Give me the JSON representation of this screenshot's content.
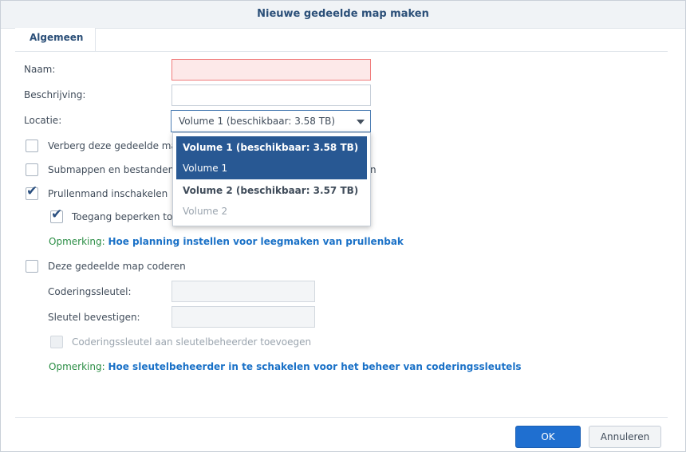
{
  "dialog": {
    "title": "Nieuwe gedeelde map maken"
  },
  "tabs": [
    {
      "label": "Algemeen"
    }
  ],
  "form": {
    "name_label": "Naam:",
    "name_value": "",
    "description_label": "Beschrijving:",
    "description_value": "",
    "location_label": "Locatie:",
    "location_value": "Volume 1 (beschikbaar: 3.58 TB)",
    "hide_folder_label": "Verberg deze gedeelde ma",
    "hide_folder_checked": false,
    "hide_subfolders_label": "Submappen en bestanden",
    "hide_subfolders_suffix": "n",
    "hide_subfolders_checked": false,
    "recycle_bin_label": "Prullenmand inschakelen",
    "recycle_bin_checked": true,
    "restrict_access_label": "Toegang beperken to",
    "restrict_access_checked": true,
    "note1_label": "Opmerking:",
    "note1_link": "Hoe planning instellen voor leegmaken van prullenbak",
    "encrypt_label": "Deze gedeelde map coderen",
    "encrypt_checked": false,
    "encryption_key_label": "Coderingssleutel:",
    "confirm_key_label": "Sleutel bevestigen:",
    "add_to_key_manager_label": "Coderingssleutel aan sleutelbeheerder toevoegen",
    "note2_label": "Opmerking:",
    "note2_link": "Hoe sleutelbeheerder in te schakelen voor het beheer van coderingssleutels"
  },
  "dropdown": {
    "options": [
      {
        "title": "Volume 1 (beschikbaar: 3.58 TB)",
        "subtitle": "Volume 1",
        "selected": true
      },
      {
        "title": "Volume 2 (beschikbaar: 3.57 TB)",
        "subtitle": "Volume 2",
        "selected": false
      }
    ]
  },
  "footer": {
    "ok_label": "OK",
    "cancel_label": "Annuleren"
  },
  "colors": {
    "accent": "#1f6fd0",
    "selection": "#285893",
    "note_label": "#2a8d44",
    "link": "#1a71c7",
    "error_bg": "#fde9e9"
  }
}
